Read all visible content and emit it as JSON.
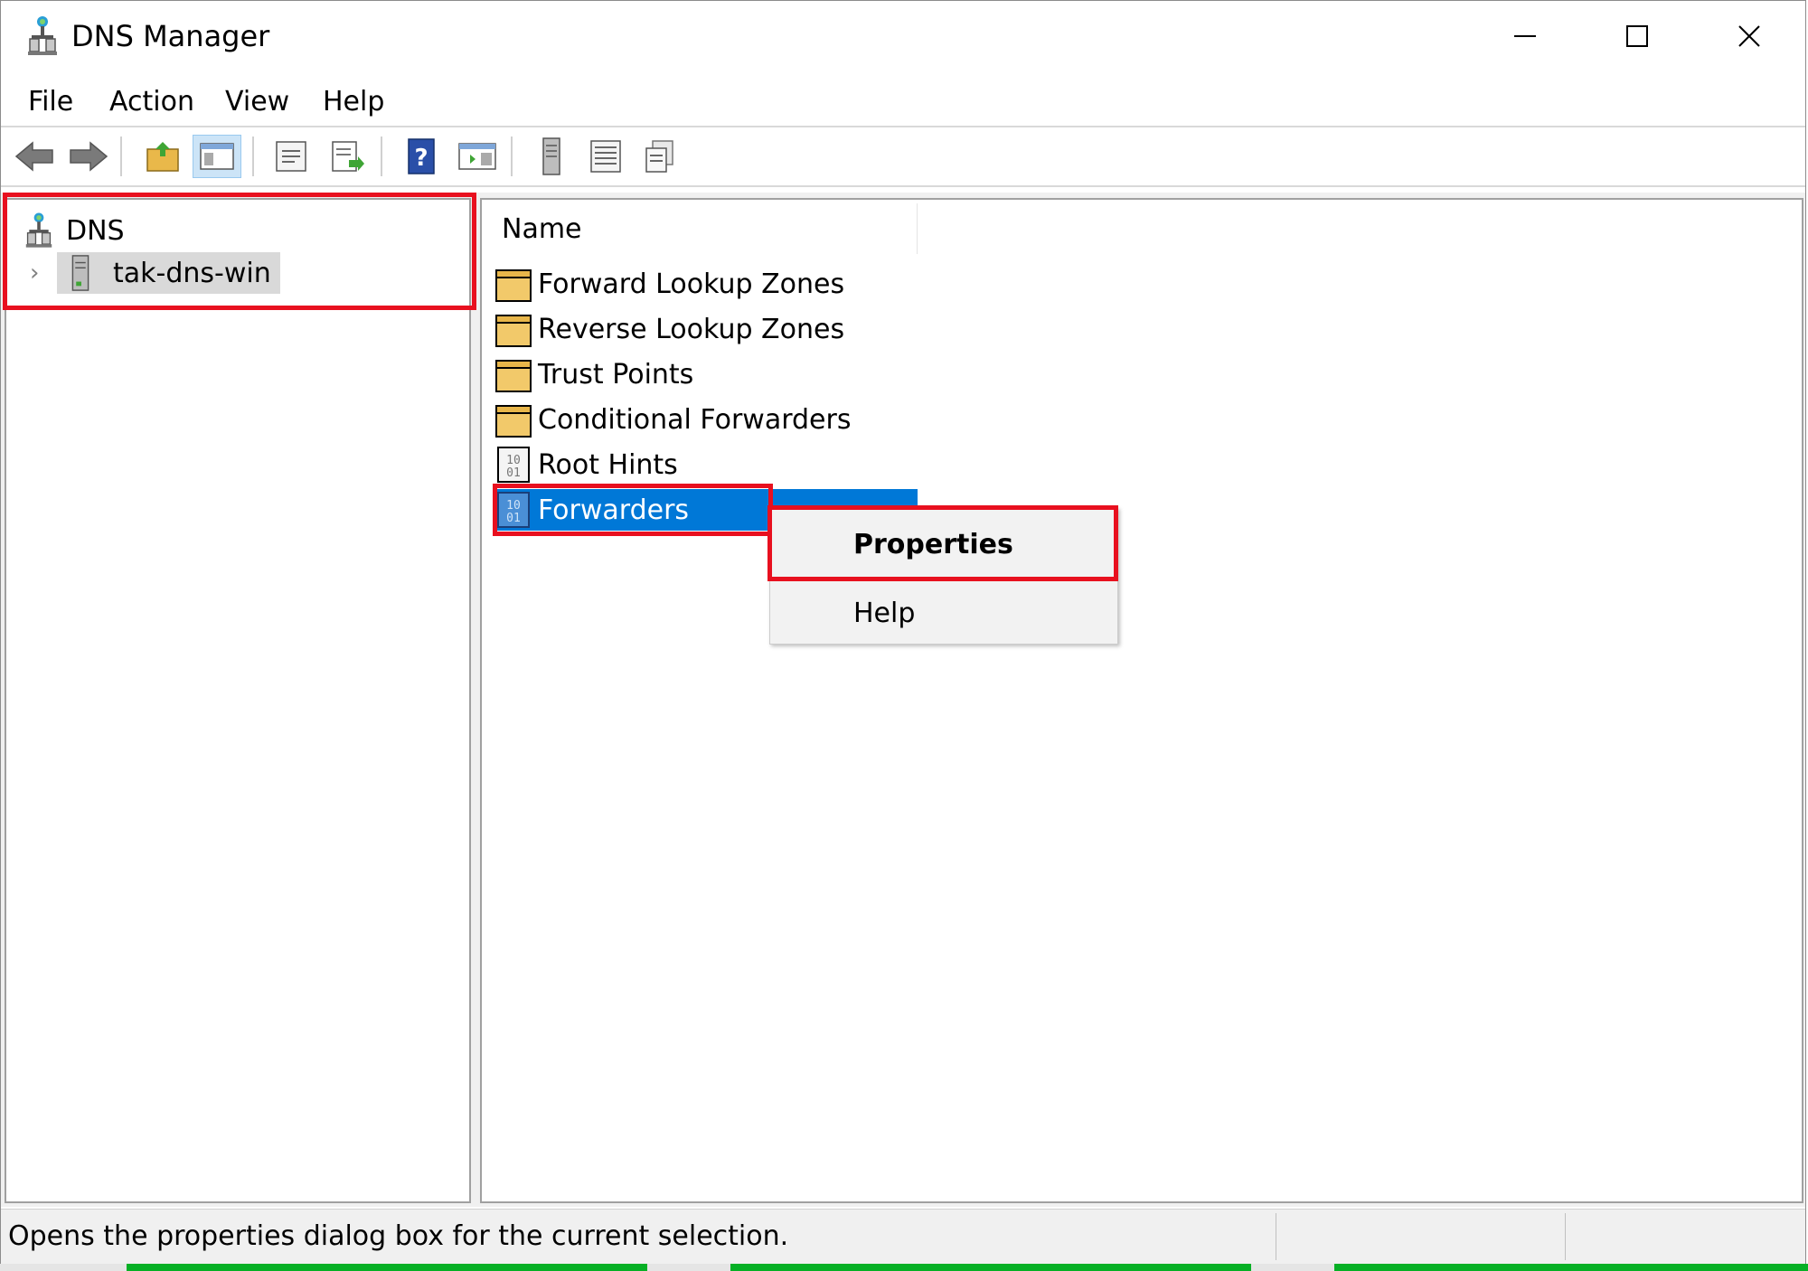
{
  "window": {
    "title": "DNS Manager"
  },
  "menu": {
    "items": [
      "File",
      "Action",
      "View",
      "Help"
    ]
  },
  "toolbar": {
    "buttons": [
      "back-arrow-icon",
      "forward-arrow-icon",
      "up-folder-icon",
      "show-hide-tree-icon",
      "properties-icon",
      "export-list-icon",
      "help-icon",
      "action-pane-icon",
      "server-icon",
      "list-view-icon",
      "details-view-icon"
    ]
  },
  "tree": {
    "root": "DNS",
    "child": "tak-dns-win",
    "expander": "›"
  },
  "list": {
    "column_name": "Name",
    "rows": [
      {
        "label": "Forward Lookup Zones",
        "icon": "folder-icon"
      },
      {
        "label": "Reverse Lookup Zones",
        "icon": "folder-icon"
      },
      {
        "label": "Trust Points",
        "icon": "folder-icon"
      },
      {
        "label": "Conditional Forwarders",
        "icon": "folder-icon"
      },
      {
        "label": "Root Hints",
        "icon": "binary-file-icon"
      },
      {
        "label": "Forwarders",
        "icon": "binary-file-icon",
        "selected": true
      }
    ]
  },
  "context_menu": {
    "items": [
      "Properties",
      "Help"
    ]
  },
  "statusbar": {
    "text": "Opens the properties dialog box for the current selection."
  },
  "colors": {
    "selection": "#0078d7",
    "highlight_box": "#e8101f",
    "tree_selection": "#d9d9d9"
  }
}
